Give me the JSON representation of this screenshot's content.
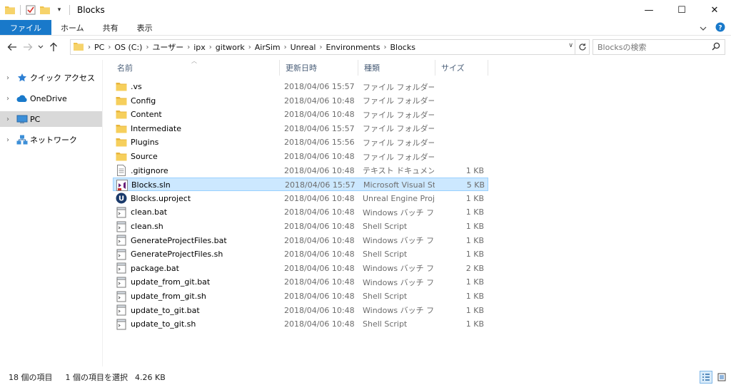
{
  "window": {
    "title": "Blocks",
    "minimize": "—",
    "maximize": "☐",
    "close": "✕"
  },
  "ribbon": {
    "tabs": [
      "ファイル",
      "ホーム",
      "共有",
      "表示"
    ],
    "expand_icon": "chevron-down-icon",
    "help_icon": "help-icon"
  },
  "address": {
    "crumbs": [
      "PC",
      "OS (C:)",
      "ユーザー",
      "ipx",
      "gitwork",
      "AirSim",
      "Unreal",
      "Environments",
      "Blocks"
    ]
  },
  "search": {
    "placeholder": "Blocksの検索"
  },
  "navpane": {
    "items": [
      {
        "label": "クイック アクセス",
        "icon": "star-icon"
      },
      {
        "label": "OneDrive",
        "icon": "cloud-icon"
      },
      {
        "label": "PC",
        "icon": "computer-icon"
      },
      {
        "label": "ネットワーク",
        "icon": "network-icon"
      }
    ]
  },
  "columns": {
    "name": "名前",
    "date": "更新日時",
    "type": "種類",
    "size": "サイズ"
  },
  "files": [
    {
      "name": ".vs",
      "date": "2018/04/06 15:57",
      "type": "ファイル フォルダー",
      "size": "",
      "icon": "folder"
    },
    {
      "name": "Config",
      "date": "2018/04/06 10:48",
      "type": "ファイル フォルダー",
      "size": "",
      "icon": "folder"
    },
    {
      "name": "Content",
      "date": "2018/04/06 10:48",
      "type": "ファイル フォルダー",
      "size": "",
      "icon": "folder"
    },
    {
      "name": "Intermediate",
      "date": "2018/04/06 15:57",
      "type": "ファイル フォルダー",
      "size": "",
      "icon": "folder"
    },
    {
      "name": "Plugins",
      "date": "2018/04/06 15:56",
      "type": "ファイル フォルダー",
      "size": "",
      "icon": "folder"
    },
    {
      "name": "Source",
      "date": "2018/04/06 10:48",
      "type": "ファイル フォルダー",
      "size": "",
      "icon": "folder"
    },
    {
      "name": ".gitignore",
      "date": "2018/04/06 10:48",
      "type": "テキスト ドキュメント",
      "size": "1 KB",
      "icon": "text"
    },
    {
      "name": "Blocks.sln",
      "date": "2018/04/06 15:57",
      "type": "Microsoft Visual St...",
      "size": "5 KB",
      "icon": "vs"
    },
    {
      "name": "Blocks.uproject",
      "date": "2018/04/06 10:48",
      "type": "Unreal Engine Proj...",
      "size": "1 KB",
      "icon": "unreal"
    },
    {
      "name": "clean.bat",
      "date": "2018/04/06 10:48",
      "type": "Windows バッチ ファ...",
      "size": "1 KB",
      "icon": "script"
    },
    {
      "name": "clean.sh",
      "date": "2018/04/06 10:48",
      "type": "Shell Script",
      "size": "1 KB",
      "icon": "script"
    },
    {
      "name": "GenerateProjectFiles.bat",
      "date": "2018/04/06 10:48",
      "type": "Windows バッチ ファ...",
      "size": "1 KB",
      "icon": "script"
    },
    {
      "name": "GenerateProjectFiles.sh",
      "date": "2018/04/06 10:48",
      "type": "Shell Script",
      "size": "1 KB",
      "icon": "script"
    },
    {
      "name": "package.bat",
      "date": "2018/04/06 10:48",
      "type": "Windows バッチ ファ...",
      "size": "2 KB",
      "icon": "script"
    },
    {
      "name": "update_from_git.bat",
      "date": "2018/04/06 10:48",
      "type": "Windows バッチ ファ...",
      "size": "1 KB",
      "icon": "script"
    },
    {
      "name": "update_from_git.sh",
      "date": "2018/04/06 10:48",
      "type": "Shell Script",
      "size": "1 KB",
      "icon": "script"
    },
    {
      "name": "update_to_git.bat",
      "date": "2018/04/06 10:48",
      "type": "Windows バッチ ファ...",
      "size": "1 KB",
      "icon": "script"
    },
    {
      "name": "update_to_git.sh",
      "date": "2018/04/06 10:48",
      "type": "Shell Script",
      "size": "1 KB",
      "icon": "script"
    }
  ],
  "selected_index": 7,
  "status": {
    "count": "18 個の項目",
    "selection": "1 個の項目を選択",
    "size": "4.26 KB"
  },
  "colors": {
    "accent": "#1979ca",
    "selection_bg": "#cce8ff",
    "selection_border": "#99d1ff",
    "folder": "#f0c24b",
    "header_text": "#4c607a"
  }
}
